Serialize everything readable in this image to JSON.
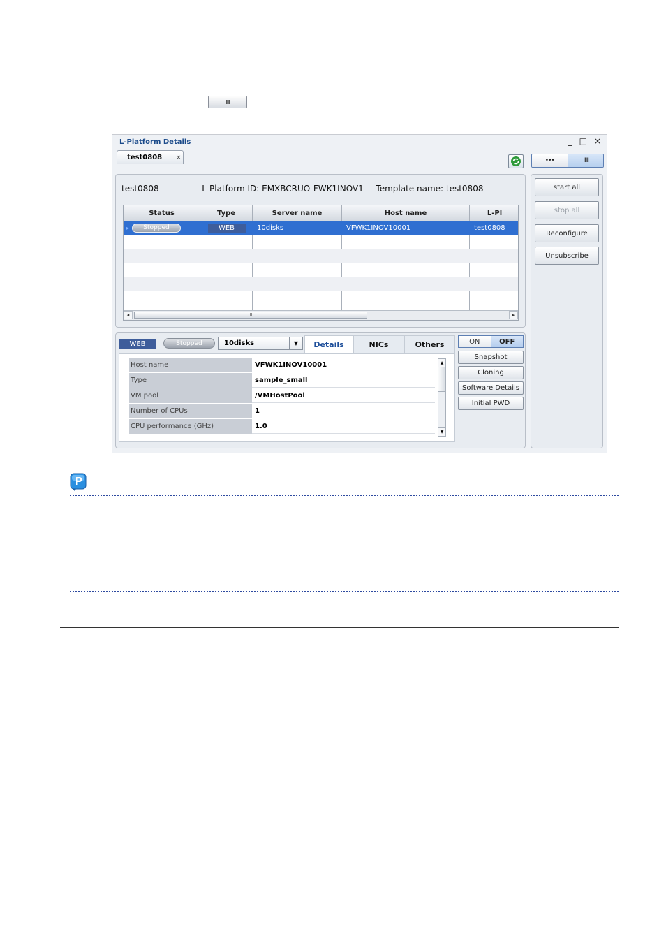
{
  "top_button": {
    "label": "IIII",
    "icon": "list-view-icon"
  },
  "window": {
    "title": "L-Platform Details",
    "controls": [
      "_",
      "□",
      "×"
    ],
    "tab": {
      "label": "test0808",
      "close": "×"
    },
    "view_toggle": [
      "•••",
      "IIII"
    ]
  },
  "summary": {
    "name": "test0808",
    "platform_id": "L-Platform ID: EMXBCRUO-FWK1INOV1",
    "template": "Template name: test0808"
  },
  "table": {
    "columns": [
      "Status",
      "Type",
      "Server name",
      "Host name",
      "L-Pl"
    ],
    "rows": [
      {
        "status": "Stopped",
        "type": "WEB",
        "server": "10disks",
        "host": "VFWK1INOV10001",
        "lplatform": "test0808"
      }
    ],
    "scroll_thumb": "III"
  },
  "actions": {
    "start_all": "start all",
    "stop_all": "stop all",
    "reconfigure": "Reconfigure",
    "unsubscribe": "Unsubscribe"
  },
  "server_detail": {
    "type_badge": "WEB",
    "status": "Stopped",
    "server_select": "10disks",
    "tabs": [
      "Details",
      "NICs",
      "Others"
    ],
    "power": {
      "on": "ON",
      "off": "OFF"
    },
    "buttons": [
      "Snapshot",
      "Cloning",
      "Software Details",
      "Initial PWD"
    ],
    "fields": [
      {
        "label": "Host name",
        "value": "VFWK1INOV10001"
      },
      {
        "label": "Type",
        "value": "sample_small"
      },
      {
        "label": "VM pool",
        "value": "/VMHostPool"
      },
      {
        "label": "Number of CPUs",
        "value": "1"
      },
      {
        "label": "CPU performance (GHz)",
        "value": "1.0"
      }
    ]
  },
  "colors": {
    "accent": "#2f6fd1",
    "badge": "#3e5d9b",
    "dotline": "#2e4aa0"
  }
}
